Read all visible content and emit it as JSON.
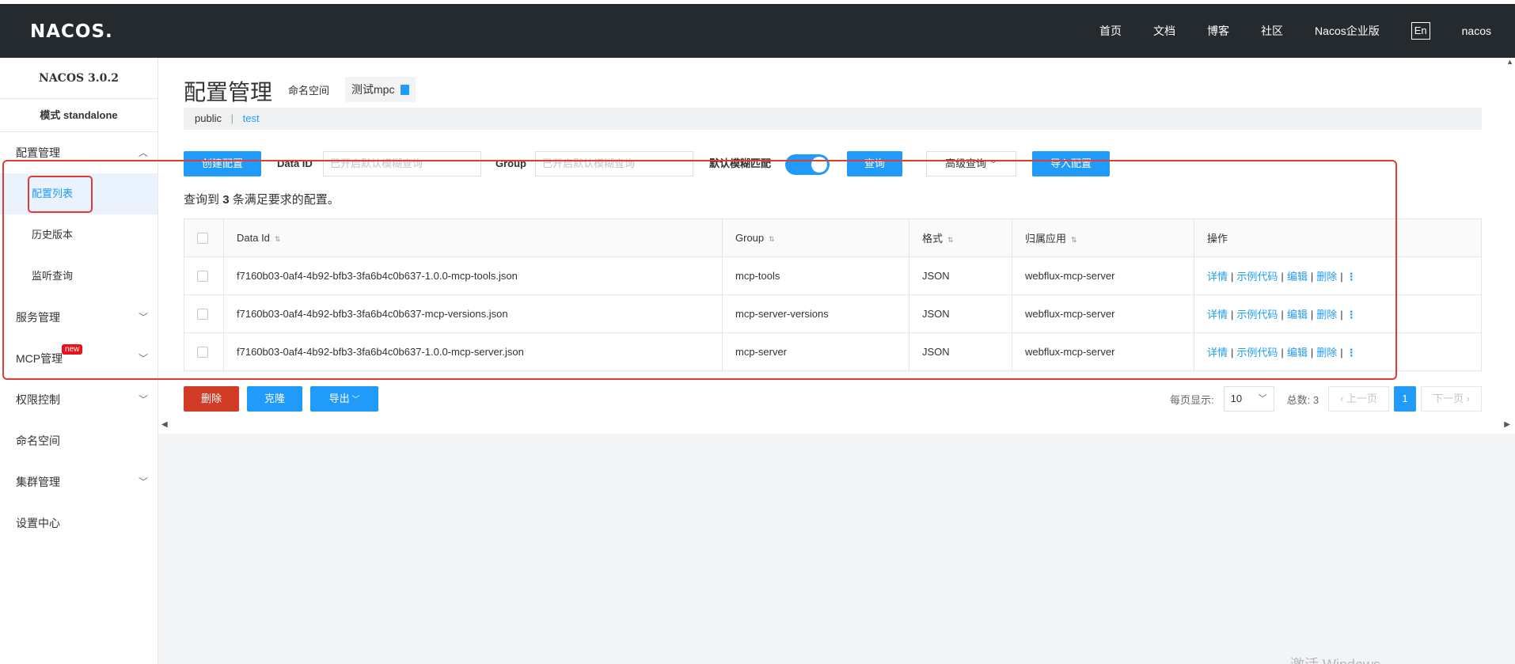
{
  "topbar": {
    "logo": "NACOS.",
    "nav": [
      "首页",
      "文档",
      "博客",
      "社区",
      "Nacos企业版"
    ],
    "lang": "En",
    "user": "nacos"
  },
  "sidebar": {
    "version": "NACOS 3.0.2",
    "mode": "模式 standalone",
    "items": [
      {
        "label": "配置管理",
        "expanded": true
      },
      {
        "label": "配置列表",
        "sub": true,
        "active": true
      },
      {
        "label": "历史版本",
        "sub": true
      },
      {
        "label": "监听查询",
        "sub": true
      },
      {
        "label": "服务管理"
      },
      {
        "label": "MCP管理",
        "badge": "new"
      },
      {
        "label": "权限控制"
      },
      {
        "label": "命名空间"
      },
      {
        "label": "集群管理"
      },
      {
        "label": "设置中心"
      }
    ]
  },
  "page": {
    "title": "配置管理",
    "namespace_label": "命名空间",
    "namespace_value": "测试mpc",
    "ns_tabs": [
      "public",
      "test"
    ]
  },
  "toolbar": {
    "create_btn": "创建配置",
    "dataid_label": "Data ID",
    "dataid_placeholder": "已开启默认模糊查询",
    "group_label": "Group",
    "group_placeholder": "已开启默认模糊查询",
    "fuzzy_label": "默认模糊匹配",
    "fuzzy_on": true,
    "query_btn": "查询",
    "advanced_btn": "高级查询",
    "import_btn": "导入配置"
  },
  "result": {
    "prefix": "查询到",
    "count": "3",
    "suffix": "条满足要求的配置。"
  },
  "table": {
    "columns": [
      "Data Id",
      "Group",
      "格式",
      "归属应用",
      "操作"
    ],
    "rows": [
      {
        "data_id": "f7160b03-0af4-4b92-bfb3-3fa6b4c0b637-1.0.0-mcp-tools.json",
        "group": "mcp-tools",
        "format": "JSON",
        "app": "webflux-mcp-server"
      },
      {
        "data_id": "f7160b03-0af4-4b92-bfb3-3fa6b4c0b637-mcp-versions.json",
        "group": "mcp-server-versions",
        "format": "JSON",
        "app": "webflux-mcp-server"
      },
      {
        "data_id": "f7160b03-0af4-4b92-bfb3-3fa6b4c0b637-1.0.0-mcp-server.json",
        "group": "mcp-server",
        "format": "JSON",
        "app": "webflux-mcp-server"
      }
    ],
    "actions": [
      "详情",
      "示例代码",
      "编辑",
      "删除"
    ]
  },
  "bottom": {
    "delete_btn": "删除",
    "clone_btn": "克隆",
    "export_btn": "导出",
    "page_size_label": "每页显示:",
    "page_size": "10",
    "total_label": "总数: 3",
    "prev": "上一页",
    "current_page": "1",
    "next": "下一页"
  },
  "watermark": "激活 Windows",
  "colors": {
    "primary": "#209bfa",
    "danger": "#d23c26",
    "topbar": "#252a2f",
    "highlight": "#e23b2f"
  }
}
